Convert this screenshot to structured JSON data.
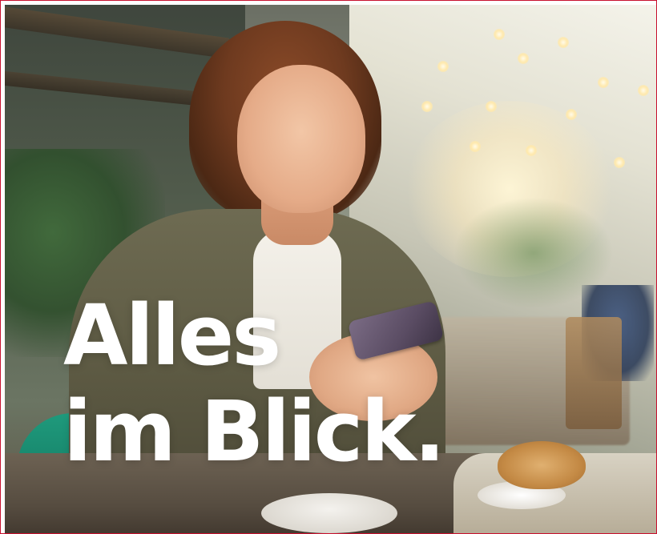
{
  "headline": {
    "line1": "Alles",
    "line2": "im Blick."
  },
  "photo": {
    "subject": "woman-using-smartphone-in-cafe"
  },
  "colors": {
    "frame_border": "#c8102e",
    "headline_text": "#ffffff"
  }
}
